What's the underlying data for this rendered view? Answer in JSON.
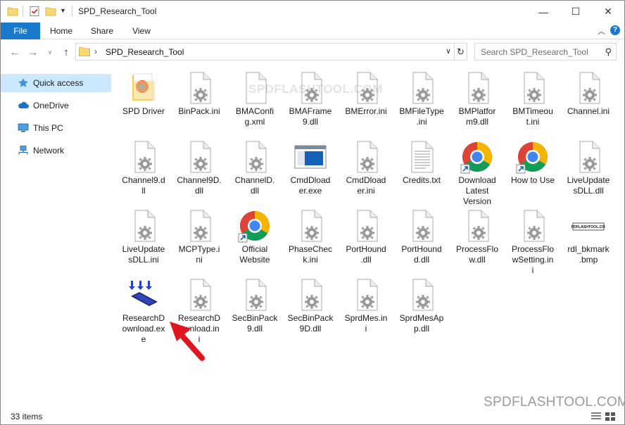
{
  "window": {
    "title": "SPD_Research_Tool",
    "minimize_icon": "minimize-icon",
    "maximize_icon": "maximize-icon",
    "close_icon": "close-icon"
  },
  "ribbon": {
    "tabs": [
      "File",
      "Home",
      "Share",
      "View"
    ],
    "collapse_icon": "chevron-up-icon",
    "help_icon": "help-icon"
  },
  "address": {
    "path": "SPD_Research_Tool",
    "search_placeholder": "Search SPD_Research_Tool"
  },
  "sidebar": {
    "items": [
      {
        "label": "Quick access",
        "icon": "star-icon",
        "active": true
      },
      {
        "label": "OneDrive",
        "icon": "cloud-icon",
        "active": false
      },
      {
        "label": "This PC",
        "icon": "computer-icon",
        "active": false
      },
      {
        "label": "Network",
        "icon": "network-icon",
        "active": false
      }
    ]
  },
  "files": [
    {
      "name": "SPD Driver",
      "type": "folder"
    },
    {
      "name": "BinPack.ini",
      "type": "settings"
    },
    {
      "name": "BMAConfig.xml",
      "type": "blank"
    },
    {
      "name": "BMAFrame9.dll",
      "type": "settings"
    },
    {
      "name": "BMError.ini",
      "type": "settings"
    },
    {
      "name": "BMFileType.ini",
      "type": "settings"
    },
    {
      "name": "BMPlatform9.dll",
      "type": "settings"
    },
    {
      "name": "BMTimeout.ini",
      "type": "settings"
    },
    {
      "name": "Channel.ini",
      "type": "settings"
    },
    {
      "name": "Channel9.dll",
      "type": "settings"
    },
    {
      "name": "Channel9D.dll",
      "type": "settings"
    },
    {
      "name": "ChannelD.dll",
      "type": "settings"
    },
    {
      "name": "CmdDloader.exe",
      "type": "exe-window"
    },
    {
      "name": "CmdDloader.ini",
      "type": "settings"
    },
    {
      "name": "Credits.txt",
      "type": "text"
    },
    {
      "name": "Download Latest Version",
      "type": "chrome"
    },
    {
      "name": "How to Use",
      "type": "chrome"
    },
    {
      "name": "LiveUpdatesDLL.dll",
      "type": "settings"
    },
    {
      "name": "LiveUpdatesDLL.ini",
      "type": "settings"
    },
    {
      "name": "MCPType.ini",
      "type": "settings"
    },
    {
      "name": "Official Website",
      "type": "chrome"
    },
    {
      "name": "PhaseCheck.ini",
      "type": "settings"
    },
    {
      "name": "PortHound.dll",
      "type": "settings"
    },
    {
      "name": "PortHound.dll",
      "type": "settings"
    },
    {
      "name": "ProcessFlow.dll",
      "type": "settings"
    },
    {
      "name": "ProcessFlowSetting.ini",
      "type": "settings"
    },
    {
      "name": "rdl_bkmark.bmp",
      "type": "bmp",
      "label_text": "SPDFLASHTOOL.COM"
    },
    {
      "name": "ResearchDownload.exe",
      "type": "research-exe"
    },
    {
      "name": "ResearchDownload.ini",
      "type": "settings"
    },
    {
      "name": "SecBinPack9.dll",
      "type": "settings"
    },
    {
      "name": "SecBinPack9D.dll",
      "type": "settings"
    },
    {
      "name": "SprdMes.ini",
      "type": "settings"
    },
    {
      "name": "SprdMesApp.dll",
      "type": "settings"
    }
  ],
  "file_name_lines": [
    [
      "SPD Driver"
    ],
    [
      "BinPack.ini"
    ],
    [
      "BMAConfi",
      "g.xml"
    ],
    [
      "BMAFrame",
      "9.dll"
    ],
    [
      "BMError.ini"
    ],
    [
      "BMFileType",
      ".ini"
    ],
    [
      "BMPlatfor",
      "m9.dll"
    ],
    [
      "BMTimeou",
      "t.ini"
    ],
    [
      "Channel.ini"
    ],
    [
      "Channel9.d",
      "ll"
    ],
    [
      "Channel9D.",
      "dll"
    ],
    [
      "ChannelD.",
      "dll"
    ],
    [
      "CmdDload",
      "er.exe"
    ],
    [
      "CmdDload",
      "er.ini"
    ],
    [
      "Credits.txt"
    ],
    [
      "Download",
      "Latest",
      "Version"
    ],
    [
      "How to Use"
    ],
    [
      "LiveUpdate",
      "sDLL.dll"
    ],
    [
      "LiveUpdate",
      "sDLL.ini"
    ],
    [
      "MCPType.i",
      "ni"
    ],
    [
      "Official",
      "Website"
    ],
    [
      "PhaseChec",
      "k.ini"
    ],
    [
      "PortHound",
      ".dll"
    ],
    [
      "PortHound",
      "d.dll"
    ],
    [
      "ProcessFlo",
      "w.dll"
    ],
    [
      "ProcessFlo",
      "wSetting.in",
      "i"
    ],
    [
      "rdl_bkmark",
      ".bmp"
    ],
    [
      "ResearchD",
      "ownload.ex",
      "e"
    ],
    [
      "ResearchD",
      "ownload.in",
      "i"
    ],
    [
      "SecBinPack",
      "9.dll"
    ],
    [
      "SecBinPack",
      "9D.dll"
    ],
    [
      "SprdMes.in",
      "i"
    ],
    [
      "SprdMesAp",
      "p.dll"
    ]
  ],
  "status": {
    "item_count": "33 items"
  },
  "watermarks": {
    "top": "SPDFLASHTOOL.COM",
    "bottom": "SPDFLASHTOOL.COM"
  },
  "annotation": {
    "arrow_color": "#e0161e",
    "points_to": "ResearchDownload.exe"
  },
  "colors": {
    "accent": "#1979ca",
    "selected": "#cce8ff"
  }
}
